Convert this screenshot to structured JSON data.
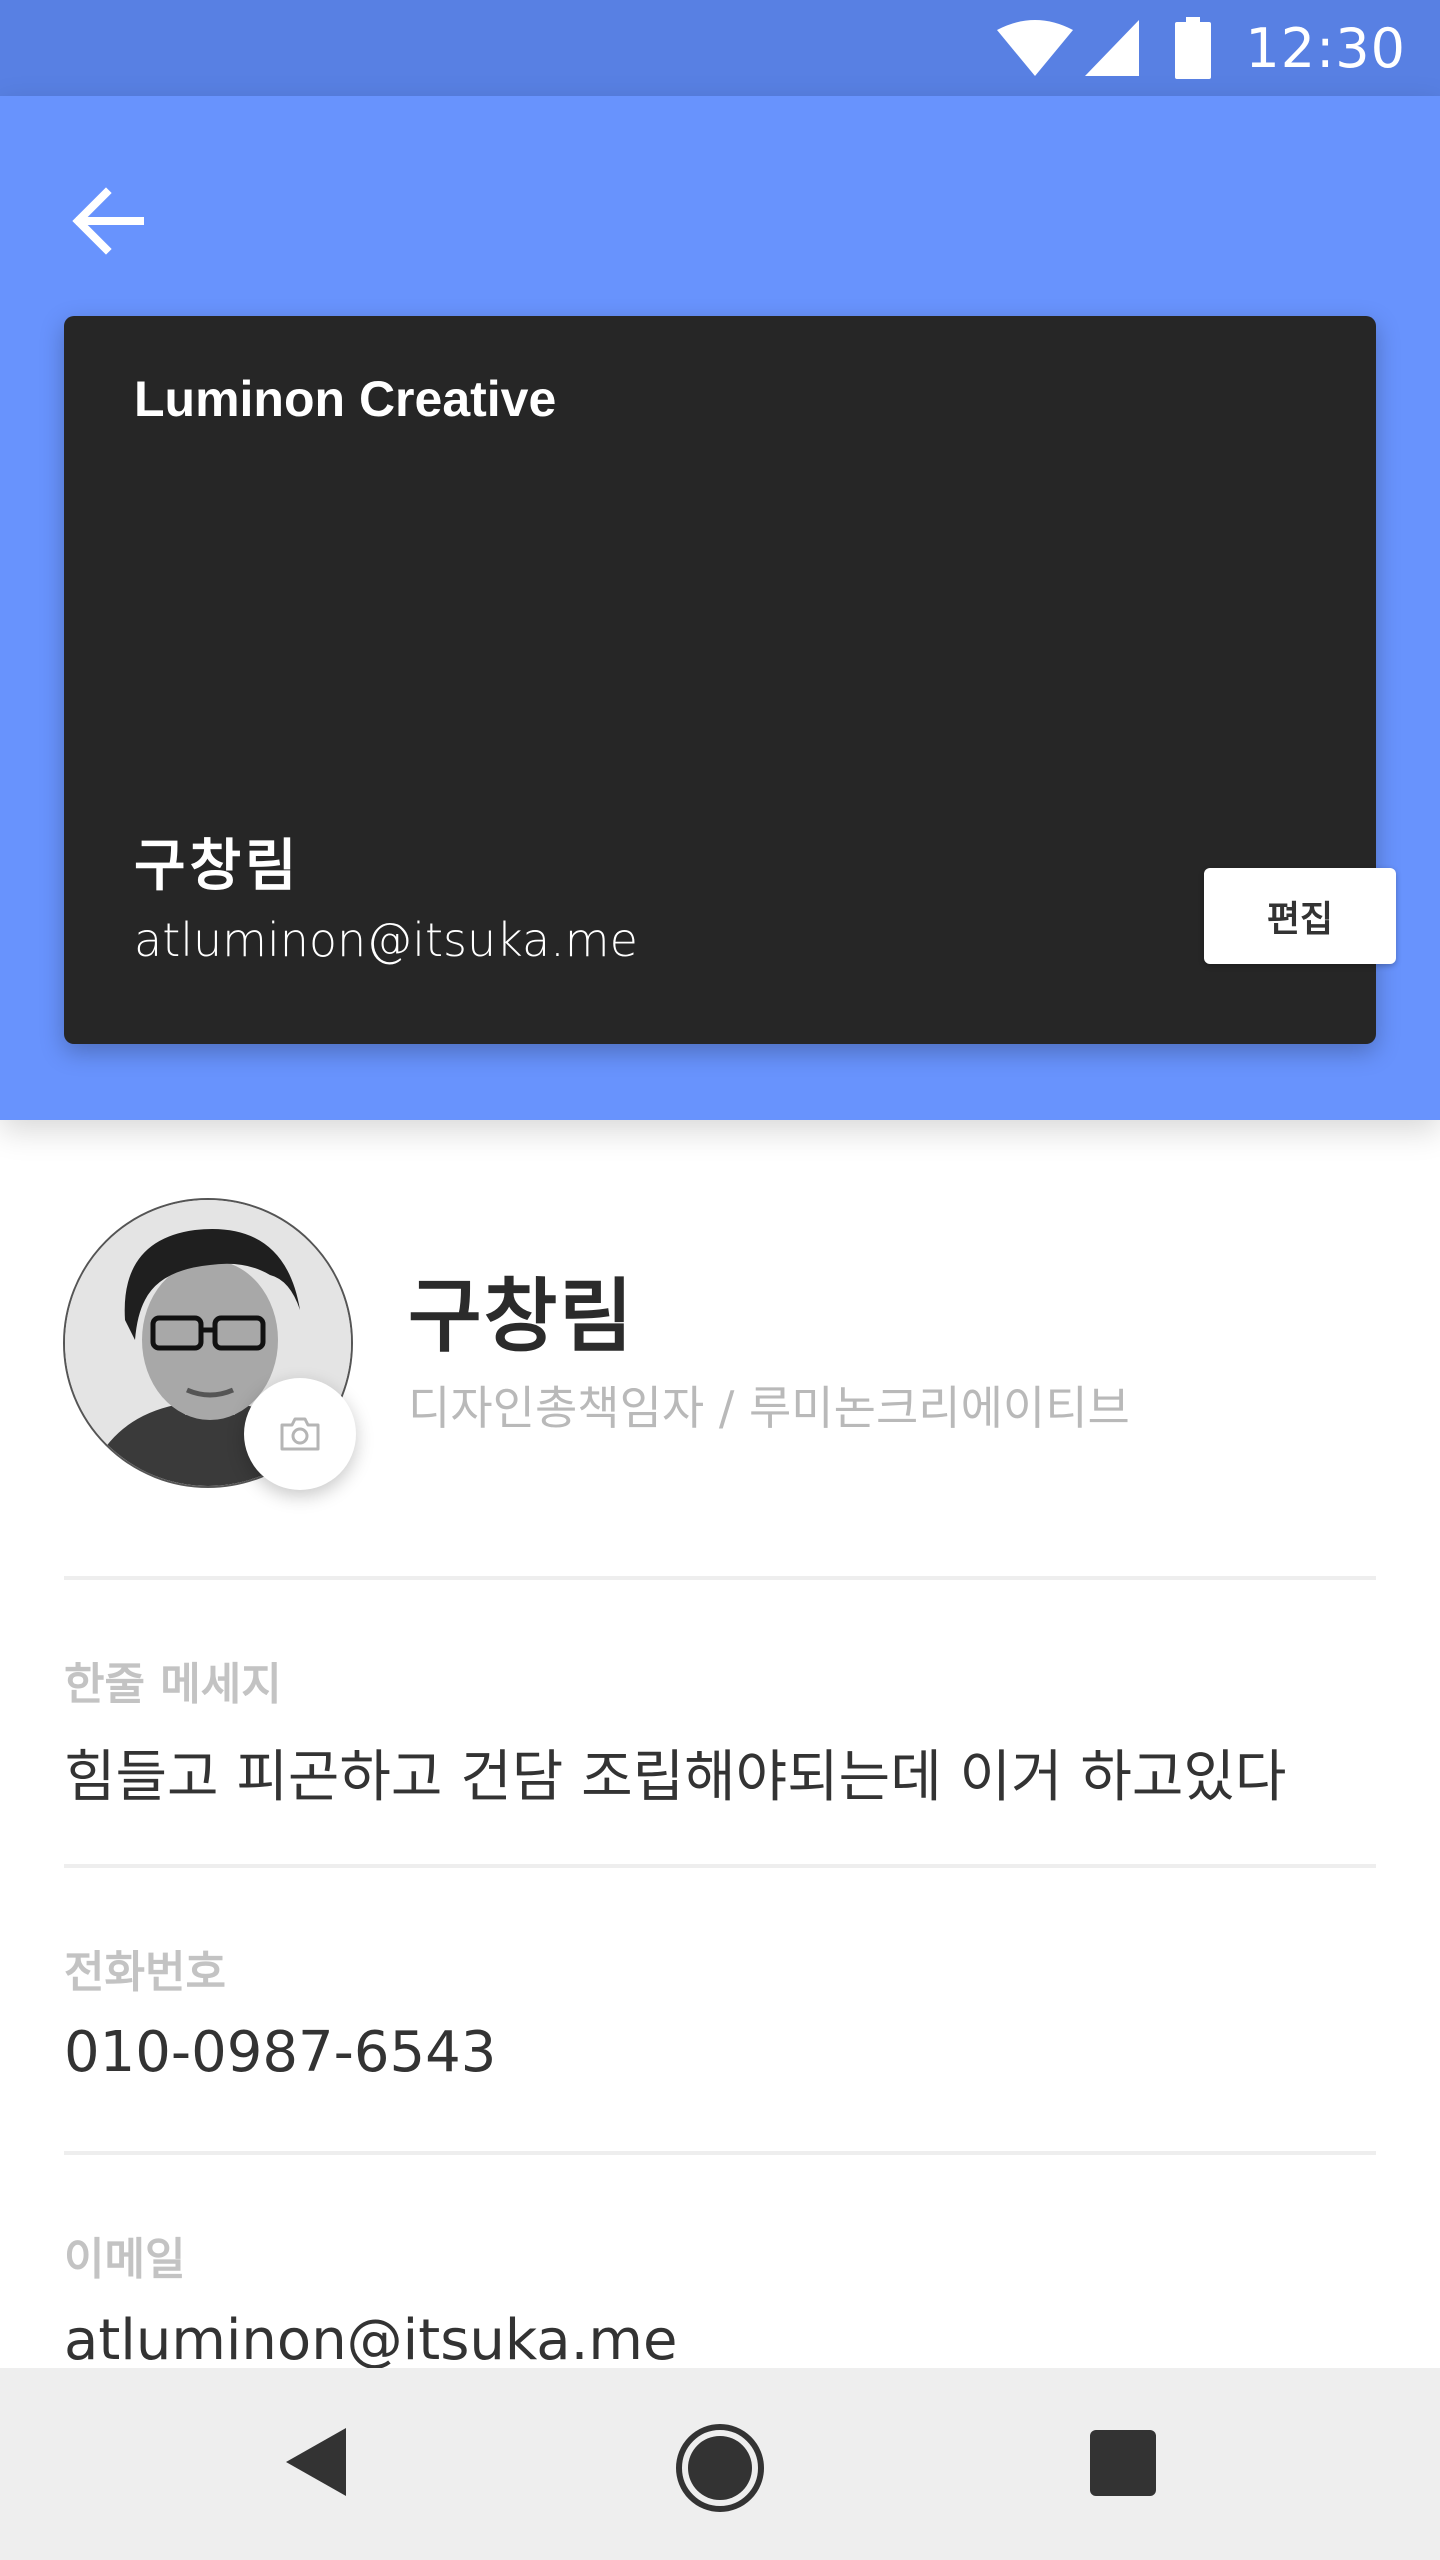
{
  "status_bar": {
    "time": "12:30",
    "icons": [
      "wifi-icon",
      "cell-signal-icon",
      "battery-icon"
    ]
  },
  "header": {
    "back_icon": "arrow-left-icon",
    "background_color": "#6893fd",
    "status_color": "#5880e3"
  },
  "card": {
    "company": "Luminon Creative",
    "name": "구창림",
    "email": "atluminon@itsuka.me",
    "edit_label": "편집",
    "background_color": "#262626"
  },
  "profile": {
    "name": "구창림",
    "role": "디자인총책임자 / 루미논크리에이티브",
    "camera_icon": "camera-icon"
  },
  "fields": [
    {
      "label": "한줄 메세지",
      "value": "힘들고 피곤하고 건담 조립해야되는데 이거 하고있다"
    },
    {
      "label": "전화번호",
      "value": "010-0987-6543"
    },
    {
      "label": "이메일",
      "value": "atluminon@itsuka.me"
    }
  ],
  "nav_bar": {
    "icons": [
      "nav-back-icon",
      "nav-home-icon",
      "nav-recent-icon"
    ]
  }
}
